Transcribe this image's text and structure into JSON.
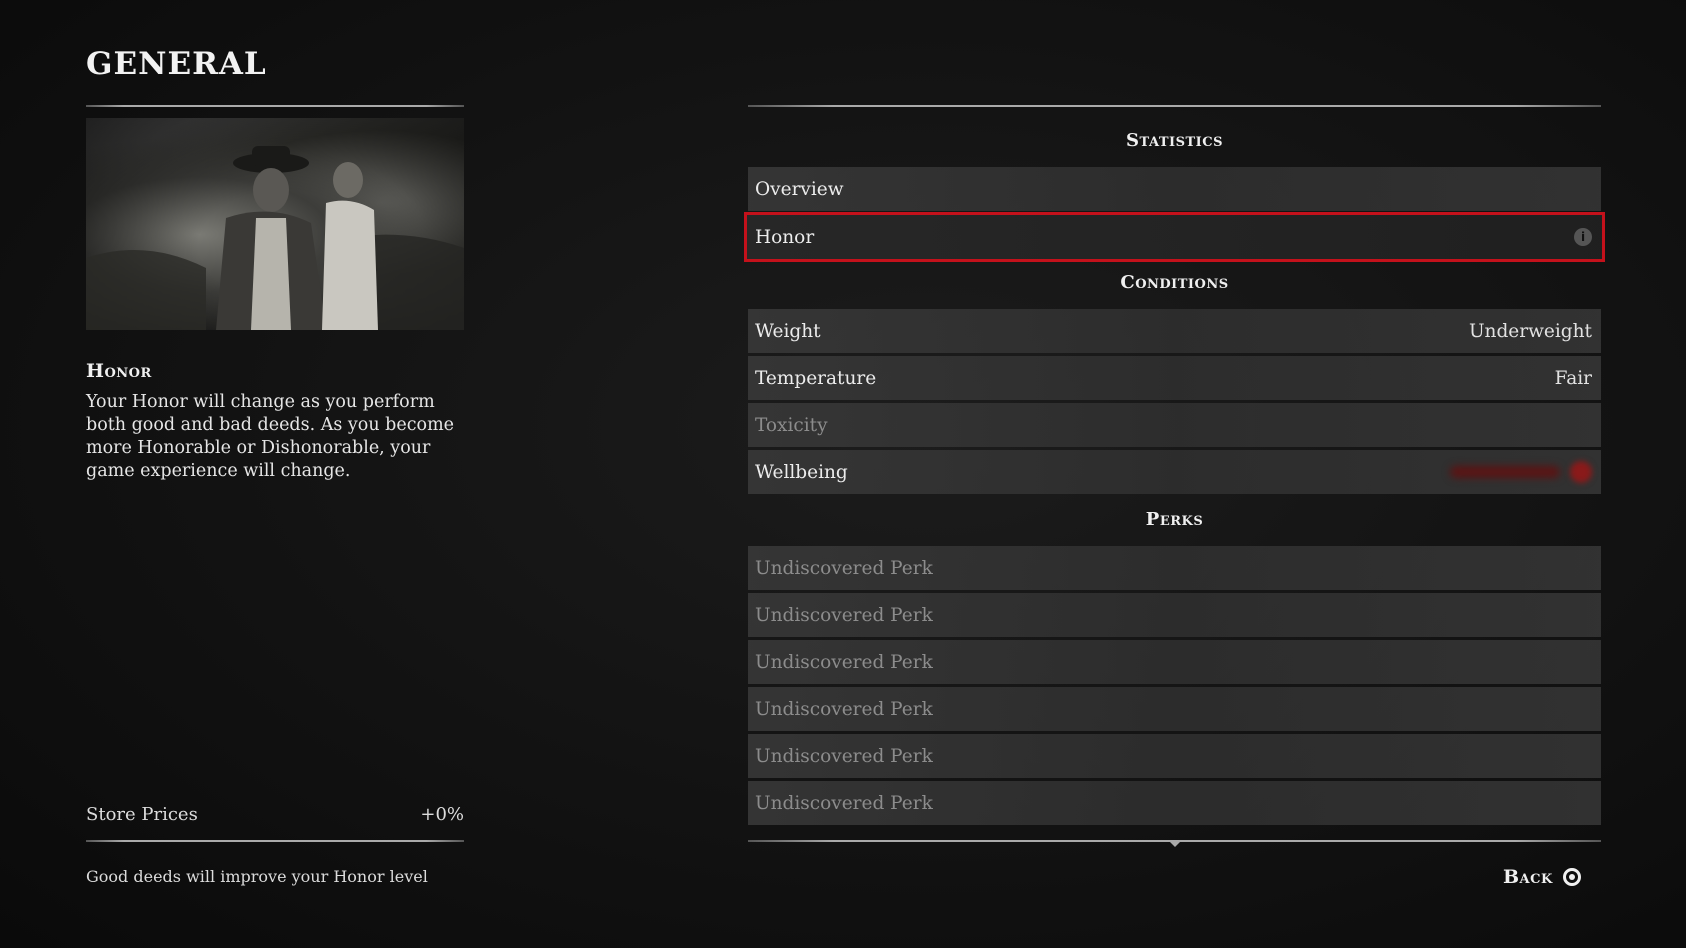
{
  "header": {
    "title": "GENERAL"
  },
  "photo": {
    "description_icon": "honor-scene-image"
  },
  "description": {
    "heading": "Honor",
    "text": "Your Honor will change as you perform both good and bad deeds. As you become more Honorable or Dishonorable, your game experience will change."
  },
  "store": {
    "label": "Store Prices",
    "value": "+0%"
  },
  "hint": "Good deeds will improve your Honor level",
  "statistics": {
    "heading": "Statistics",
    "items": [
      {
        "label": "Overview"
      },
      {
        "label": "Honor",
        "icon": "info-icon"
      }
    ]
  },
  "conditions": {
    "heading": "Conditions",
    "items": [
      {
        "label": "Weight",
        "value": "Underweight"
      },
      {
        "label": "Temperature",
        "value": "Fair"
      },
      {
        "label": "Toxicity",
        "value": ""
      },
      {
        "label": "Wellbeing",
        "value": ""
      }
    ]
  },
  "perks": {
    "heading": "Perks",
    "items": [
      {
        "label": "Undiscovered Perk"
      },
      {
        "label": "Undiscovered Perk"
      },
      {
        "label": "Undiscovered Perk"
      },
      {
        "label": "Undiscovered Perk"
      },
      {
        "label": "Undiscovered Perk"
      },
      {
        "label": "Undiscovered Perk"
      }
    ]
  },
  "footer": {
    "back_label": "Back",
    "back_icon": "circle-button-icon"
  },
  "colors": {
    "selection_outline": "#c4111b",
    "background": "#121212"
  }
}
